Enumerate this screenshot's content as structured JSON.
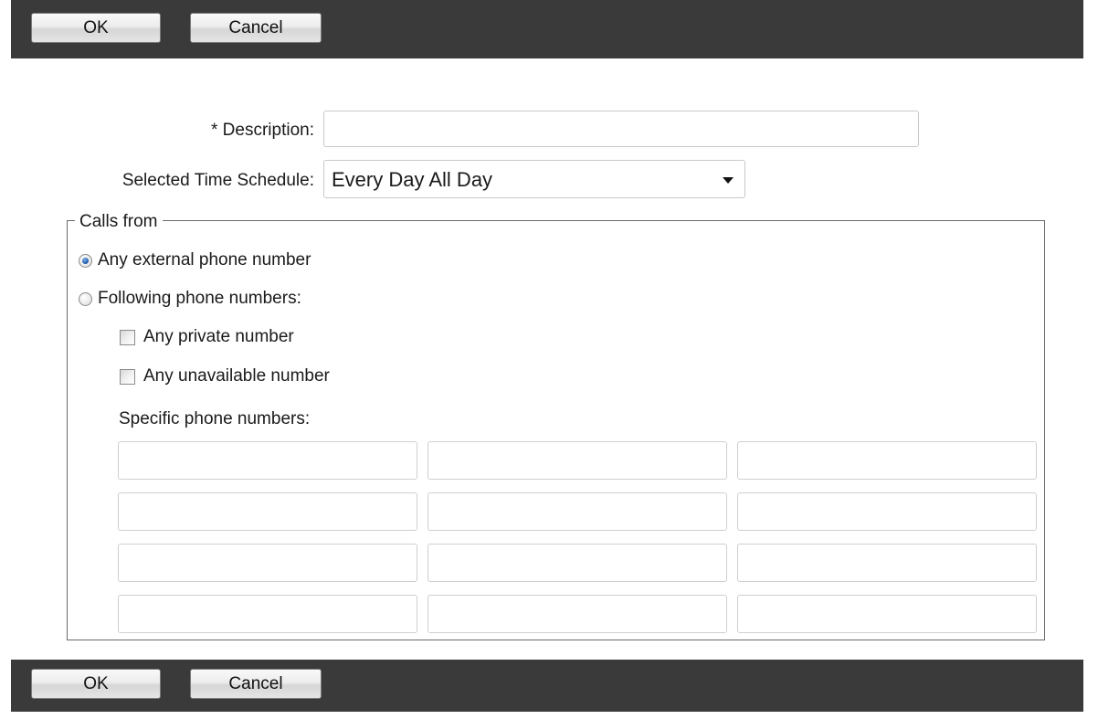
{
  "toolbar_top": {
    "ok_label": "OK",
    "cancel_label": "Cancel"
  },
  "toolbar_bottom": {
    "ok_label": "OK",
    "cancel_label": "Cancel"
  },
  "form": {
    "description_label": "* Description:",
    "description_value": "",
    "schedule_label": "Selected Time Schedule:",
    "schedule_value": "Every Day All Day"
  },
  "calls_from": {
    "legend": "Calls from",
    "options": {
      "any_external": {
        "label": "Any external phone number",
        "checked": true
      },
      "following": {
        "label": "Following phone numbers:",
        "checked": false
      }
    },
    "checkboxes": {
      "any_private": {
        "label": "Any private number",
        "checked": false
      },
      "any_unavailable": {
        "label": "Any unavailable number",
        "checked": false
      }
    },
    "specific_label": "Specific phone numbers:",
    "phone_numbers": [
      "",
      "",
      "",
      "",
      "",
      "",
      "",
      "",
      "",
      "",
      "",
      ""
    ]
  },
  "icons": {
    "dropdown": "chevron-down-icon",
    "radio": "radio-icon",
    "checkbox": "checkbox-icon"
  },
  "colors": {
    "toolbar_bg": "#3a3a3a",
    "radio_selected": "#1f5fb0"
  }
}
